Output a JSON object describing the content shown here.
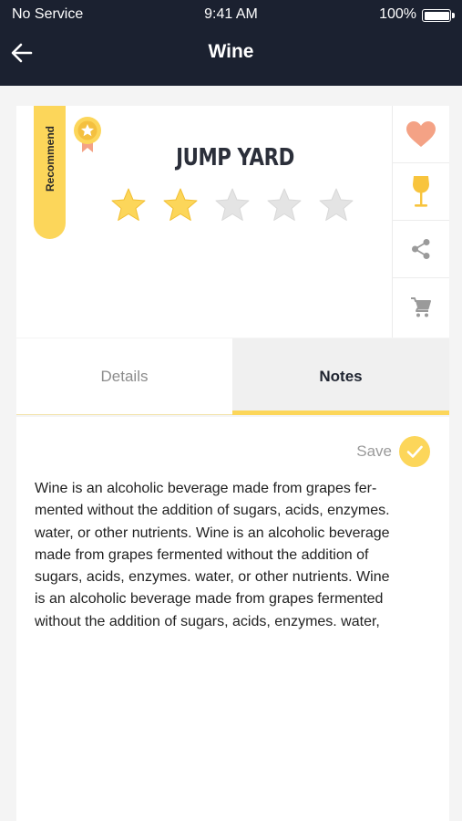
{
  "status_bar": {
    "carrier": "No Service",
    "time": "9:41 AM",
    "battery": "100%"
  },
  "header": {
    "title": "Wine",
    "back_icon": "arrow-left-icon"
  },
  "product": {
    "badge": "Recommend",
    "name": "JUMP YARD",
    "rating": 2,
    "rating_max": 5
  },
  "actions": [
    {
      "name": "favorite-button",
      "icon": "heart-icon"
    },
    {
      "name": "wine-glass-button",
      "icon": "wine-glass-icon"
    },
    {
      "name": "share-button",
      "icon": "share-icon"
    },
    {
      "name": "cart-button",
      "icon": "cart-icon"
    }
  ],
  "tabs": [
    {
      "label": "Details",
      "active": false
    },
    {
      "label": "Notes",
      "active": true
    }
  ],
  "notes": {
    "save_label": "Save",
    "text": "Wine is an alcoholic beverage made from grapes fer-\nmented without the addition of sugars, acids, enzymes.\nwater, or other nutrients. Wine is an alcoholic beverage\nmade from grapes fermented without the addition of\nsugars, acids, enzymes. water, or other nutrients. Wine\nis an alcoholic beverage made from grapes fermented\nwithout the addition of sugars, acids, enzymes. water,"
  },
  "colors": {
    "header_bg": "#1b2130",
    "accent": "#fcd65a",
    "heart": "#f4a285",
    "star_empty": "#e4e4e4"
  }
}
